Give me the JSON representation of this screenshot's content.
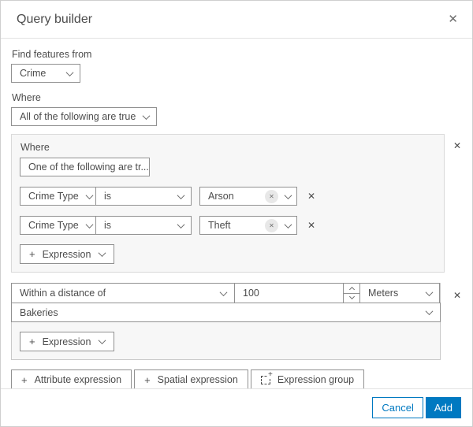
{
  "header": {
    "title": "Query builder"
  },
  "icons": {
    "plus": "+",
    "close": "✕",
    "chip_remove": "✕",
    "row_remove": "✕"
  },
  "find_features": {
    "label": "Find features from",
    "selected": "Crime"
  },
  "where": {
    "label": "Where",
    "selected": "All of the following are true"
  },
  "group1": {
    "label": "Where",
    "operator": "One of the following are tr...",
    "rows": [
      {
        "field": "Crime Type",
        "operator": "is",
        "value": "Arson"
      },
      {
        "field": "Crime Type",
        "operator": "is",
        "value": "Theft"
      }
    ],
    "add_expression_label": "Expression"
  },
  "group2": {
    "operator": "Within a distance of",
    "distance_value": "100",
    "unit": "Meters",
    "layer": "Bakeries",
    "add_expression_label": "Expression"
  },
  "actions": {
    "attribute_expression": "Attribute expression",
    "spatial_expression": "Spatial expression",
    "expression_group": "Expression group"
  },
  "footer": {
    "cancel": "Cancel",
    "add": "Add"
  },
  "colors": {
    "accent": "#0079c1",
    "input_border": "#919191",
    "group_border": "#dadada",
    "group_bg": "#f7f7f7",
    "text": "#4c4c4c"
  }
}
